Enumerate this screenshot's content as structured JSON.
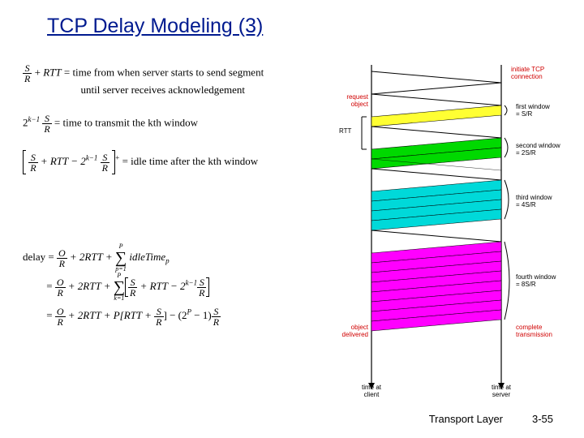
{
  "title": "TCP Delay Modeling (3)",
  "equations": {
    "eq1_lhs_num": "S",
    "eq1_lhs_den": "R",
    "eq1_plus": " + ",
    "eq1_rtt": "RTT",
    "eq1_eq": " = ",
    "eq1_rhs_a": "time from when server starts to send segment",
    "eq1_rhs_b": "until server receives acknowledgement",
    "eq2_coef": "2",
    "eq2_exp": "k−1",
    "eq2_num": "S",
    "eq2_den": "R",
    "eq2_rhs": " = time to transmit the kth window",
    "eq3_inside_a_num": "S",
    "eq3_inside_a_den": "R",
    "eq3_inside_plus": " + RTT − 2",
    "eq3_inside_exp": "k−1",
    "eq3_inside_b_num": "S",
    "eq3_inside_b_den": "R",
    "eq3_sup": "+",
    "eq3_rhs": " = idle time after the kth window",
    "eq4_lhs": "delay = ",
    "eq4_O": "O",
    "eq4_R": "R",
    "eq4_line1_mid": " + 2RTT + ",
    "eq4_line1_end": " idleTime",
    "eq4_line1_sub": "p",
    "eq4_sum_top": "P",
    "eq4_sum_bot1": "p=1",
    "eq4_line2_pre": " + 2RTT + ",
    "eq4_line2_inside": " + RTT − 2",
    "eq4_line2_exp": "k−1",
    "eq4_sum_bot2": "k=1",
    "eq4_line3_pre": " + 2RTT + P[RTT + ",
    "eq4_line3_mid": "] − (2",
    "eq4_line3_exp": "P",
    "eq4_line3_end": " − 1)",
    "eq4_eq": " = "
  },
  "diagram": {
    "initiate": "initiate TCP\nconnection",
    "request": "request\nobject",
    "rtt": "RTT",
    "delivered": "object\ndelivered",
    "client": "time at\nclient",
    "server": "time at\nserver",
    "complete": "complete\ntransmission",
    "w1": "first window\n= S/R",
    "w2": "second window\n= 2S/R",
    "w3": "third window\n= 4S/R",
    "w4": "fourth window\n= 8S/R"
  },
  "footer": {
    "layer": "Transport Layer",
    "page": "3-55"
  },
  "chart_data": {
    "type": "diagram",
    "description": "TCP slow-start delay timeline between client and server",
    "events_client": [
      "initiate TCP connection",
      "request object",
      "RTT interval",
      "object delivered"
    ],
    "windows": [
      {
        "name": "first window",
        "size": "S/R",
        "segments": 1,
        "color": "#ffff33"
      },
      {
        "name": "second window",
        "size": "2S/R",
        "segments": 2,
        "color": "#00d900"
      },
      {
        "name": "third window",
        "size": "4S/R",
        "segments": 4,
        "color": "#00d9d9"
      },
      {
        "name": "fourth window",
        "size": "8S/R",
        "segments": 8,
        "color": "#ff00ff"
      }
    ],
    "axes": {
      "left": "time at client",
      "right": "time at server"
    },
    "delay_formula": "delay = O/R + 2RTT + sum_{p=1..P} idleTime_p"
  }
}
